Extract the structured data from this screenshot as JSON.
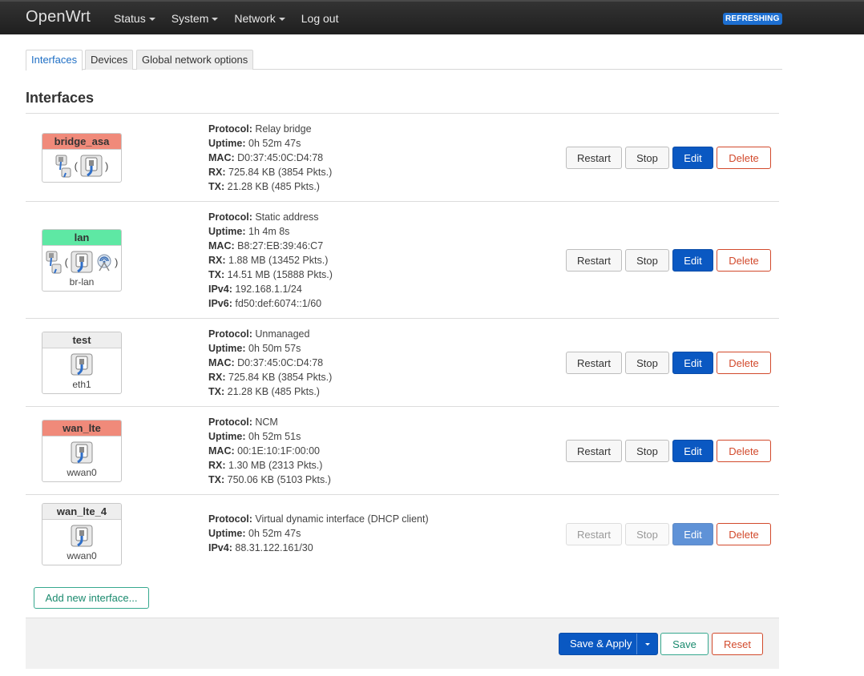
{
  "brand": "OpenWrt",
  "menu": [
    {
      "label": "Status",
      "dropdown": true
    },
    {
      "label": "System",
      "dropdown": true
    },
    {
      "label": "Network",
      "dropdown": true
    },
    {
      "label": "Log out",
      "dropdown": false
    }
  ],
  "refresh_badge": "REFRESHING",
  "tabs": [
    {
      "label": "Interfaces",
      "active": true
    },
    {
      "label": "Devices",
      "active": false
    },
    {
      "label": "Global network options",
      "active": false
    }
  ],
  "section_title": "Interfaces",
  "buttons": {
    "restart": "Restart",
    "stop": "Stop",
    "edit": "Edit",
    "delete": "Delete"
  },
  "interfaces": [
    {
      "name": "bridge_asa",
      "color": "#f08a7a",
      "device": "",
      "icon_set": "bridge-with-wifi",
      "disabled_actions": false,
      "details": [
        {
          "label": "Protocol:",
          "value": "Relay bridge"
        },
        {
          "label": "Uptime:",
          "value": "0h 52m 47s"
        },
        {
          "label": "MAC:",
          "value": "D0:37:45:0C:D4:78"
        },
        {
          "label": "RX:",
          "value": "725.84 KB (3854 Pkts.)"
        },
        {
          "label": "TX:",
          "value": "21.28 KB (485 Pkts.)"
        }
      ]
    },
    {
      "name": "lan",
      "color": "#5ee8a4",
      "device": "br-lan",
      "icon_set": "bridge-with-wireless",
      "disabled_actions": false,
      "details": [
        {
          "label": "Protocol:",
          "value": "Static address"
        },
        {
          "label": "Uptime:",
          "value": "1h 4m 8s"
        },
        {
          "label": "MAC:",
          "value": "B8:27:EB:39:46:C7"
        },
        {
          "label": "RX:",
          "value": "1.88 MB (13452 Pkts.)"
        },
        {
          "label": "TX:",
          "value": "14.51 MB (15888 Pkts.)"
        },
        {
          "label": "IPv4:",
          "value": "192.168.1.1/24"
        },
        {
          "label": "IPv6:",
          "value": "fd50:def:6074::1/60"
        }
      ]
    },
    {
      "name": "test",
      "color": "#eeeeee",
      "device": "eth1",
      "icon_set": "ethernet",
      "disabled_actions": false,
      "details": [
        {
          "label": "Protocol:",
          "value": "Unmanaged"
        },
        {
          "label": "Uptime:",
          "value": "0h 50m 57s"
        },
        {
          "label": "MAC:",
          "value": "D0:37:45:0C:D4:78"
        },
        {
          "label": "RX:",
          "value": "725.84 KB (3854 Pkts.)"
        },
        {
          "label": "TX:",
          "value": "21.28 KB (485 Pkts.)"
        }
      ]
    },
    {
      "name": "wan_lte",
      "color": "#f08a7a",
      "device": "wwan0",
      "icon_set": "ethernet",
      "disabled_actions": false,
      "details": [
        {
          "label": "Protocol:",
          "value": "NCM"
        },
        {
          "label": "Uptime:",
          "value": "0h 52m 51s"
        },
        {
          "label": "MAC:",
          "value": "00:1E:10:1F:00:00"
        },
        {
          "label": "RX:",
          "value": "1.30 MB (2313 Pkts.)"
        },
        {
          "label": "TX:",
          "value": "750.06 KB (5103 Pkts.)"
        }
      ]
    },
    {
      "name": "wan_lte_4",
      "color": "#eeeeee",
      "device": "wwan0",
      "icon_set": "ethernet",
      "disabled_actions": true,
      "details": [
        {
          "label": "Protocol:",
          "value": "Virtual dynamic interface (DHCP client)"
        },
        {
          "label": "Uptime:",
          "value": "0h 52m 47s"
        },
        {
          "label": "IPv4:",
          "value": "88.31.122.161/30"
        }
      ]
    }
  ],
  "add_button": "Add new interface...",
  "footer": {
    "save_apply": "Save & Apply",
    "save": "Save",
    "reset": "Reset"
  }
}
